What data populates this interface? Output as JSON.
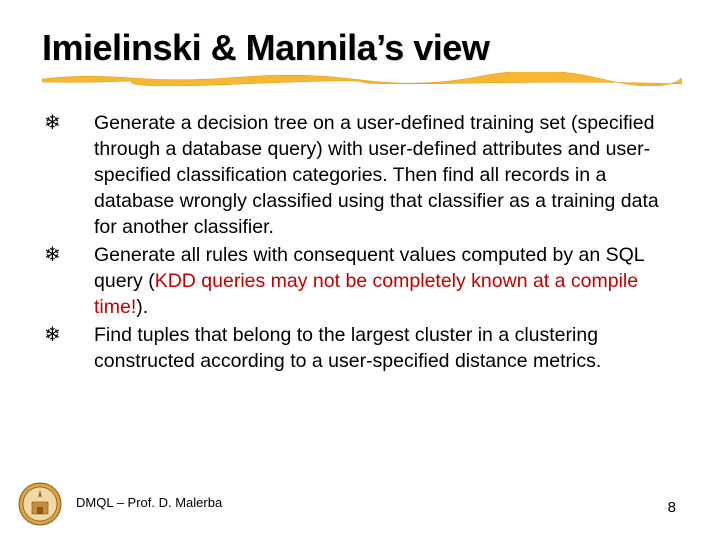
{
  "title": "Imielinski & Mannila’s view",
  "bullet_glyph": "❄",
  "items": [
    {
      "text": "Generate a decision tree on a user-defined training set (specified through a database query) with user-defined attributes and user-specified classification categories. Then find all records in a database wrongly classified using that classifier as a training data for another classifier."
    },
    {
      "pre": "Generate all rules with consequent values computed by an SQL query (",
      "hl": "KDD queries may not be completely known at a compile time!",
      "post": ")."
    },
    {
      "text": "Find tuples that belong to the largest cluster in a clustering constructed according to a user-specified distance metrics."
    }
  ],
  "footer": "DMQL – Prof. D. Malerba",
  "page": "8"
}
